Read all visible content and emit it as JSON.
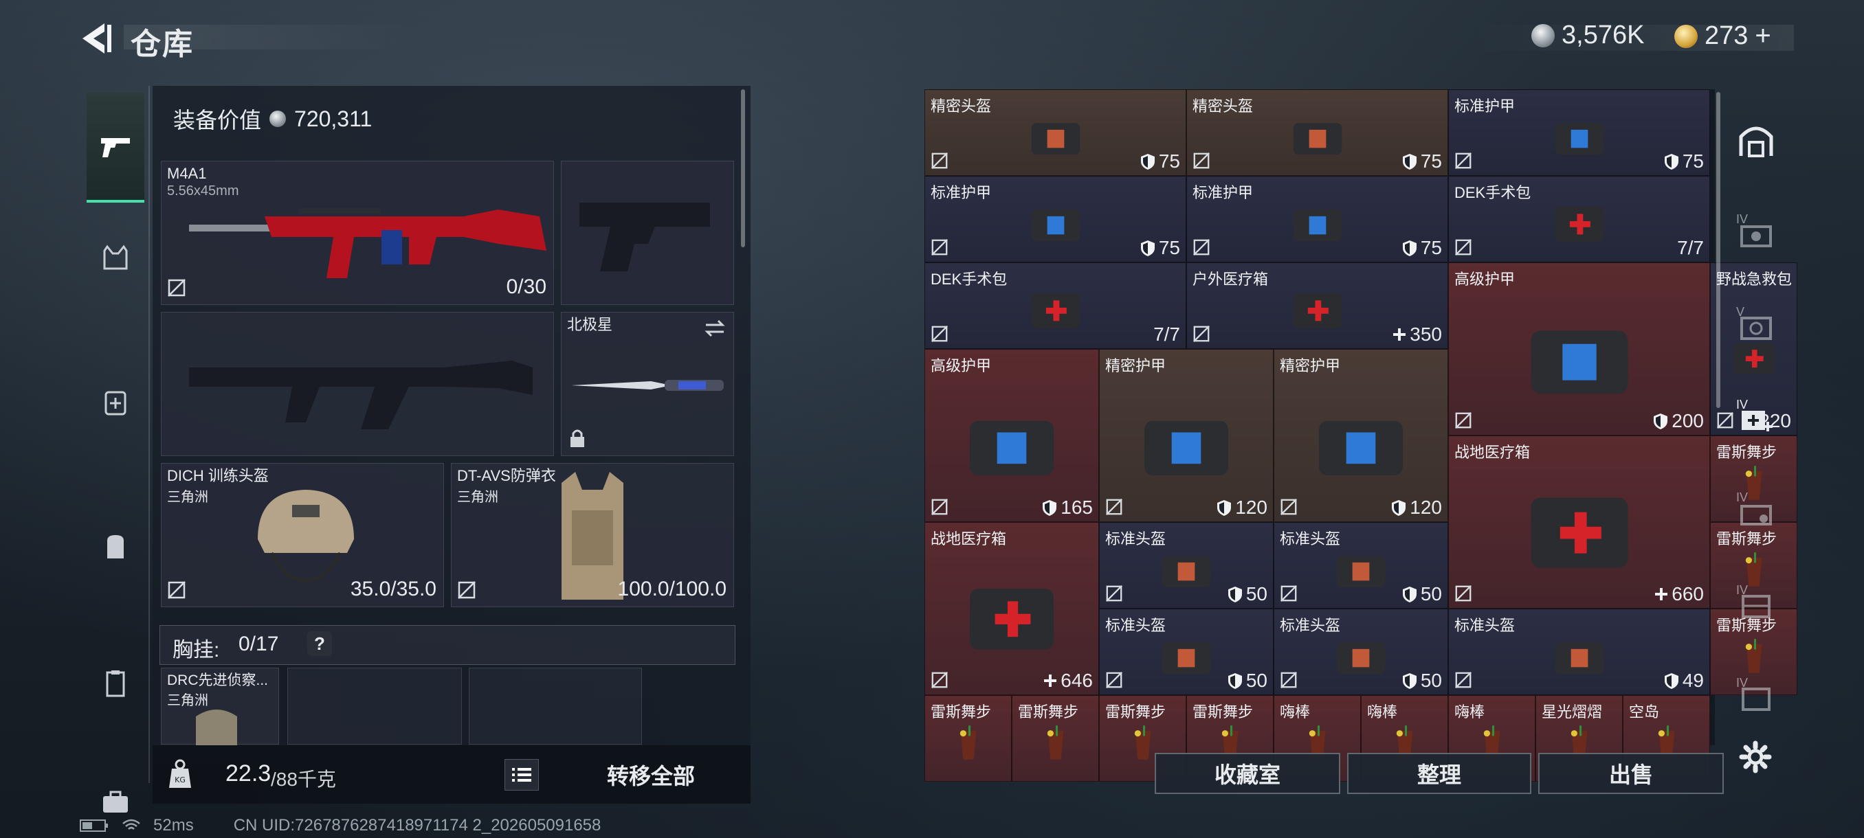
{
  "header": {
    "title": "仓库"
  },
  "currency": {
    "silver": "3,576K",
    "gold": "273",
    "gold_add": "+"
  },
  "left": {
    "equip_value_label": "装备价值",
    "equip_value": "720,311",
    "weapon1": {
      "name": "M4A1",
      "ammo": "5.56x45mm",
      "value": "0/30"
    },
    "knife": {
      "name": "北极星"
    },
    "helmet": {
      "name": "DICH 训练头盔",
      "map": "三角洲",
      "value": "35.0/35.0"
    },
    "armor": {
      "name": "DT-AVS防弹衣",
      "map": "三角洲",
      "value": "100.0/100.0"
    },
    "chest": {
      "label": "胸挂:",
      "value": "0/17",
      "help": "?"
    },
    "backpack": {
      "name": "DRC先进侦察...",
      "map": "三角洲"
    },
    "weight": "22.3",
    "weight_max": "/88千克",
    "transfer_all": "转移全部"
  },
  "grid": [
    {
      "name": "精密头盔",
      "value": "75",
      "kind": "shield",
      "bg": "brown"
    },
    {
      "name": "精密头盔",
      "value": "75",
      "kind": "shield",
      "bg": "brown"
    },
    {
      "name": "标准护甲",
      "value": "75",
      "kind": "shield",
      "bg": "navy"
    },
    {
      "name": "标准护甲",
      "value": "75",
      "kind": "shield",
      "bg": "navy"
    },
    {
      "name": "标准护甲",
      "value": "75",
      "kind": "shield",
      "bg": "navy"
    },
    {
      "name": "DEK手术包",
      "value": "7/7",
      "kind": "plain",
      "bg": "navy"
    },
    {
      "name": "DEK手术包",
      "value": "7/7",
      "kind": "plain",
      "bg": "navy"
    },
    {
      "name": "户外医疗箱",
      "value": "350",
      "kind": "plus",
      "bg": "navy"
    },
    {
      "name": "高级护甲",
      "value": "200",
      "kind": "shield",
      "bg": "red"
    },
    {
      "name": "野战急救包",
      "value": "220",
      "kind": "plus",
      "bg": "navy"
    },
    {
      "name": "高级护甲",
      "value": "165",
      "kind": "shield",
      "bg": "red"
    },
    {
      "name": "精密护甲",
      "value": "120",
      "kind": "shield",
      "bg": "brown"
    },
    {
      "name": "精密护甲",
      "value": "120",
      "kind": "shield",
      "bg": "brown"
    },
    {
      "name": "战地医疗箱",
      "value": "660",
      "kind": "plus",
      "bg": "red"
    },
    {
      "name": "雷斯舞步",
      "value": "",
      "kind": "none",
      "bg": "red"
    },
    {
      "name": "雷斯舞步",
      "value": "",
      "kind": "none",
      "bg": "red"
    },
    {
      "name": "战地医疗箱",
      "value": "646",
      "kind": "plus",
      "bg": "red"
    },
    {
      "name": "标准头盔",
      "value": "50",
      "kind": "shield",
      "bg": "navy"
    },
    {
      "name": "标准头盔",
      "value": "50",
      "kind": "shield",
      "bg": "navy"
    },
    {
      "name": "标准头盔",
      "value": "50",
      "kind": "shield",
      "bg": "navy"
    },
    {
      "name": "标准头盔",
      "value": "50",
      "kind": "shield",
      "bg": "navy"
    },
    {
      "name": "标准头盔",
      "value": "49",
      "kind": "shield",
      "bg": "navy"
    },
    {
      "name": "雷斯舞步",
      "value": "",
      "kind": "none",
      "bg": "red"
    },
    {
      "name": "雷斯舞步",
      "value": "",
      "kind": "none",
      "bg": "red"
    },
    {
      "name": "雷斯舞步",
      "value": "",
      "kind": "none",
      "bg": "red"
    },
    {
      "name": "雷斯舞步",
      "value": "",
      "kind": "none",
      "bg": "red"
    },
    {
      "name": "雷斯舞步",
      "value": "",
      "kind": "none",
      "bg": "red"
    },
    {
      "name": "嗨棒",
      "value": "",
      "kind": "none",
      "bg": "red"
    },
    {
      "name": "嗨棒",
      "value": "",
      "kind": "none",
      "bg": "red"
    },
    {
      "name": "嗨棒",
      "value": "",
      "kind": "none",
      "bg": "red"
    },
    {
      "name": "星光熠熠",
      "value": "",
      "kind": "none",
      "bg": "red"
    },
    {
      "name": "空岛",
      "value": "",
      "kind": "none",
      "bg": "red"
    }
  ],
  "buttons": {
    "collection": "收藏室",
    "organize": "整理",
    "sell": "出售"
  },
  "status": {
    "ping": "52ms",
    "uid": "CN UID:7267876287418971174 2_202605091658"
  },
  "right_tabs": [
    "IV",
    "V",
    "IV",
    "IV",
    "IV",
    "IV"
  ]
}
